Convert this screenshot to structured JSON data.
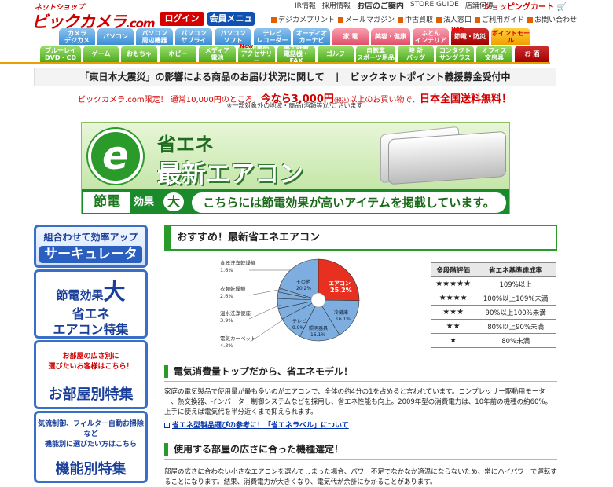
{
  "header": {
    "logo_small": "ネットショップ",
    "logo_main": "ビックカメラ",
    "logo_com": ".com",
    "login": "ログイン",
    "member_menu": "会員メニュー",
    "top_links": [
      "IR情報",
      "採用情報",
      "お店のご案内",
      "STORE GUIDE",
      "店舗何導"
    ],
    "cart": "ショッピングカート",
    "sub_links": [
      "デジカメプリント",
      "メールマガジン",
      "中古買取",
      "法人窓口",
      "ご利用ガイド",
      "お問い合わせ"
    ]
  },
  "nav": {
    "row1": [
      "カメラ\nデジカメ",
      "パソコン",
      "パソコン\n周辺機器",
      "パソコン\nサプライ",
      "パソコン\nソフト",
      "テレビ\nレコーダー",
      "オーディオ\nカーナビ",
      "家 電",
      "美容・健康",
      "ふとん\nインテリア",
      "節電・防災",
      "ポイントモール"
    ],
    "row2": [
      "ブルーレイ\nDVD・CD",
      "ゲーム",
      "おもちゃ",
      "ホビー",
      "メディア\n電池",
      "携帯電話\nアクセサリー",
      "電子辞書\n電話機・FAX",
      "ゴルフ",
      "自転車\nスポーツ用品",
      "時 計\nバッグ",
      "コンタクト\nサングラス",
      "オフィス\n文房具",
      "お 酒"
    ],
    "new_badge": "New"
  },
  "notices": {
    "earthquake": "「東日本大震災」の影響による商品のお届け状況に関して",
    "separator": "|",
    "point": "ビックネットポイント義援募金受付中",
    "ship_a": "ビックカメラ.com限定！ 通常10,000円のところ、",
    "ship_b": "今なら3,000円",
    "ship_c": "(税込)",
    "ship_d": "以上のお買い物で、",
    "ship_e": "日本全国送料無料！",
    "ship_note": "※一部対象外の地域・商品(酒類等)がございます"
  },
  "banner": {
    "e": "e",
    "t1": "省エネ",
    "t2": "最新エアコン",
    "setsuden": "節電",
    "kouka": "効果",
    "dai": "大",
    "msg": "こちらには節電効果が高いアイテムを掲載しています。"
  },
  "sidebar": {
    "s1_l1": "組合わせて効率アップ",
    "s1_l2": "サーキュレータ",
    "s2_l1": "節電効果",
    "s2_dai": "大",
    "s2_l2": "省エネ",
    "s2_l3": "エアコン特集",
    "s3_l1": "お部屋の広さ別に",
    "s3_l1b": "選びたいお客様はこちら！",
    "s3_l2": "お部屋別特集",
    "s4_l1": "気流制御、フィルター自動お掃除など",
    "s4_l1b": "機能別に選びたい方はこちら",
    "s4_l2": "機能別特集"
  },
  "main": {
    "title": "おすすめ！最新省エネエアコン",
    "h_top": "電気消費量トップだから、省エネモデル！",
    "para1": "家庭の電気製品で使用量が最も多いのがエアコンで、全体の約4分の1を占めると言われています。コンプレッサー駆動用モーター、熱交換器、インバーター制御システムなどを採用し、省エネ性能も向上。2009年型の消費電力は、10年前の機種の約60%。上手に使えば電気代を半分近くまで抑えられます。",
    "link1": "省エネ型製品選びの参考に！「省エネラベル」について",
    "h_room": "使用する部屋の広さに合った機種選定！",
    "para2": "部屋の広さに合わない小さなエアコンを選んでしまった場合、パワー不足でなかなか適温にならないため、常にハイパワーで運転することになります。結果、消費電力が大きくなり、電気代が余計にかかることがあります。"
  },
  "rating_table": {
    "headers": [
      "多段階評価",
      "省エネ基準達成率"
    ],
    "rows": [
      {
        "stars": "★★★★★",
        "rate": "109%以上"
      },
      {
        "stars": "★★★★",
        "rate": "100%以上109%未満"
      },
      {
        "stars": "★★★",
        "rate": "90%以上100%未満"
      },
      {
        "stars": "★★",
        "rate": "80%以上90%未満"
      },
      {
        "stars": "★",
        "rate": "80%未満"
      }
    ]
  },
  "chart_data": {
    "type": "pie",
    "slices": [
      {
        "label": "エアコン",
        "value": 25.2,
        "color": "#e83020"
      },
      {
        "label": "冷蔵庫",
        "value": 16.1,
        "color": "#7eaee0"
      },
      {
        "label": "照明器具",
        "value": 16.1,
        "color": "#7eaee0"
      },
      {
        "label": "テレビ",
        "value": 9.9,
        "color": "#7eaee0"
      },
      {
        "label": "電気カーペット",
        "value": 4.3,
        "color": "#7eaee0"
      },
      {
        "label": "温水洗浄便座",
        "value": 3.9,
        "color": "#7eaee0"
      },
      {
        "label": "衣類乾燥機",
        "value": 2.6,
        "color": "#7eaee0"
      },
      {
        "label": "食器洗浄乾燥機",
        "value": 1.6,
        "color": "#7eaee0"
      },
      {
        "label": "その他",
        "value": 20.2,
        "color": "#7eaee0"
      }
    ],
    "labels_text": {
      "aircon": "エアコン",
      "aircon_v": "25.2%",
      "reizo": "冷蔵庫",
      "reizo_v": "16.1%",
      "shomei": "照明器具",
      "shomei_v": "16.1%",
      "tv": "テレビ",
      "tv_v": "9.9%",
      "carpet": "電気カーペット",
      "carpet_v": "4.3%",
      "benza": "温水洗浄便座",
      "benza_v": "3.9%",
      "irui": "衣類乾燥機",
      "irui_v": "2.6%",
      "shokki": "食器洗浄乾燥機",
      "shokki_v": "1.6%",
      "sonota": "その他",
      "sonota_v": "20.2%"
    }
  }
}
